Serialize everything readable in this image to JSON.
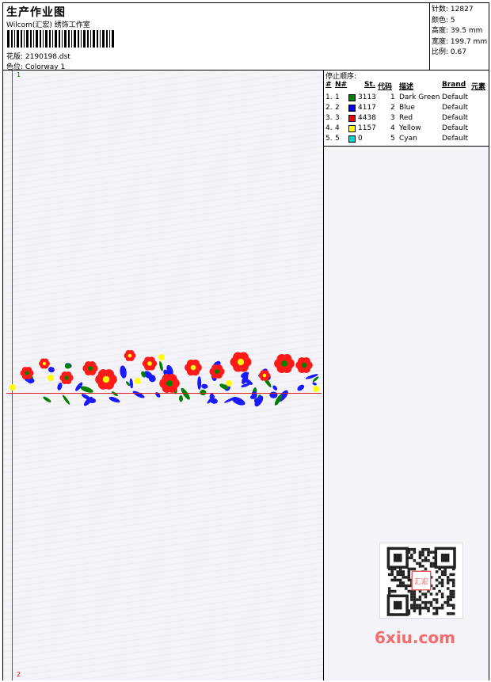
{
  "header": {
    "title": "生产作业图",
    "company": "Wilcom(汇宏) 绣饰工作室",
    "pattern_label": "花版:",
    "pattern_value": "2190198.dst",
    "colorway_label": "色位:",
    "colorway_value": "Colorway 1"
  },
  "stats": [
    {
      "label": "针数:",
      "value": "12827"
    },
    {
      "label": "颜色:",
      "value": "5"
    },
    {
      "label": "高度:",
      "value": "39.5 mm"
    },
    {
      "label": "宽度:",
      "value": "199.7 mm"
    },
    {
      "label": "比例:",
      "value": "0.67"
    }
  ],
  "markers": {
    "start": "1",
    "end": "2"
  },
  "stops": {
    "title": "停止顺序:",
    "headers": {
      "idx": "#",
      "n": "N#",
      "st": "St.",
      "code": "代码",
      "desc": "描述",
      "brand": "Brand",
      "elem": "元素"
    },
    "rows": [
      {
        "idx": "1.",
        "n": "1",
        "color": "#008000",
        "st": "3113",
        "code": "1",
        "desc": "Dark Green",
        "brand": "Default"
      },
      {
        "idx": "2.",
        "n": "2",
        "color": "#0000ff",
        "st": "4117",
        "code": "2",
        "desc": "Blue",
        "brand": "Default"
      },
      {
        "idx": "3.",
        "n": "3",
        "color": "#ff0000",
        "st": "4438",
        "code": "3",
        "desc": "Red",
        "brand": "Default"
      },
      {
        "idx": "4.",
        "n": "4",
        "color": "#ffff00",
        "st": "1157",
        "code": "4",
        "desc": "Yellow",
        "brand": "Default"
      },
      {
        "idx": "5.",
        "n": "5",
        "color": "#00d8d8",
        "st": "0",
        "code": "5",
        "desc": "Cyan",
        "brand": "Default"
      }
    ]
  },
  "watermark": {
    "brand": "6xiu.com",
    "seal": "汇宏"
  },
  "colors": {
    "green": "#008000",
    "blue": "#1a1aff",
    "red": "#ff1a1a",
    "yellow": "#ffff00",
    "guide": "#e02020"
  }
}
